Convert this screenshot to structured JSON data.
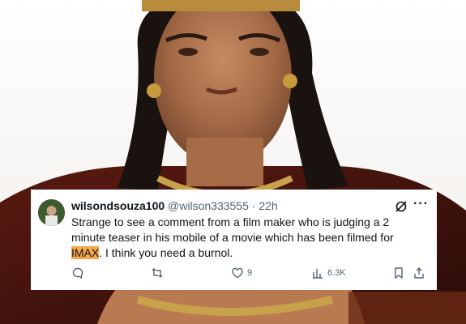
{
  "tweet": {
    "display_name": "wilsondsouza100",
    "handle": "@wilson333555",
    "separator": "·",
    "time": "22h",
    "text_before": "Strange to see a comment from a film maker who is judging a 2 minute teaser in his mobile of a movie which has been filmed for ",
    "highlight": "IMAX",
    "text_after": ". I think you need a burnol.",
    "likes": "9",
    "views": "6.3K"
  },
  "colors": {
    "highlight": "#f5a64b",
    "text": "#0f1419",
    "muted": "#536471"
  },
  "icons": [
    "grok-icon",
    "more-icon",
    "reply-icon",
    "retweet-icon",
    "like-icon",
    "views-icon",
    "bookmark-icon",
    "share-icon"
  ]
}
